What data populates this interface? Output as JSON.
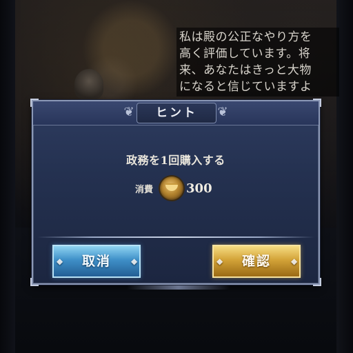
{
  "speech": {
    "lines": [
      "私は殿の公正なやり方を",
      "高く評価しています。将",
      "来、あなたはきっと大物",
      "になると信じていますよ"
    ]
  },
  "dialog": {
    "title": "ヒント",
    "message": "政務を1回購入する",
    "cost_label": "消費",
    "currency_icon": "gold-ingot-icon",
    "cost_value": "300",
    "cancel_label": "取消",
    "confirm_label": "確認"
  },
  "colors": {
    "dialog_bg": "#243150",
    "cancel_button": "#3f90c8",
    "confirm_button": "#d3a338"
  }
}
